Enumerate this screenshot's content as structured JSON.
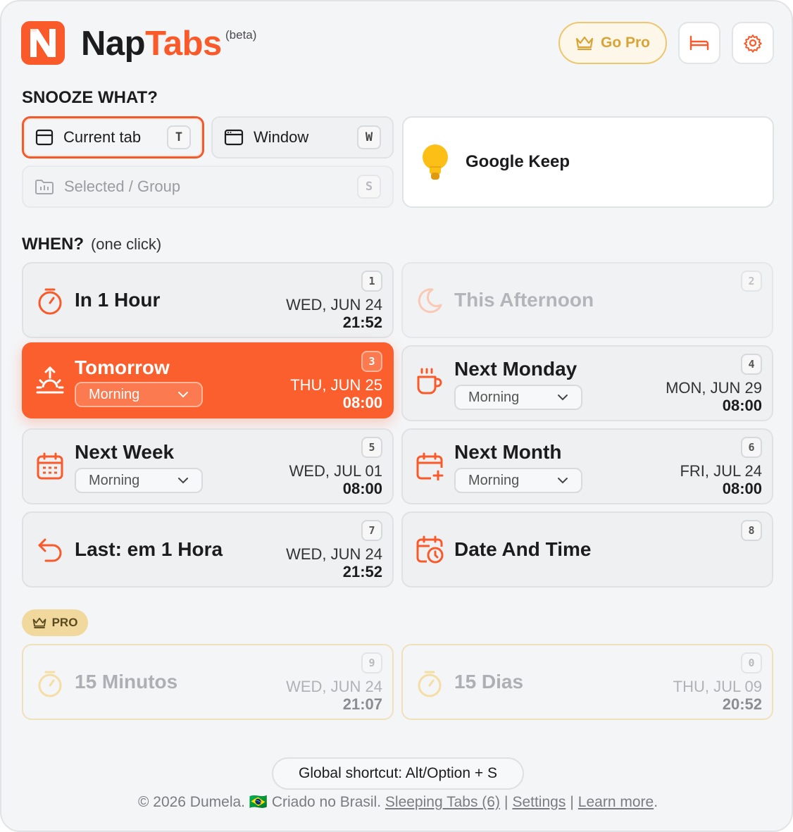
{
  "header": {
    "brand_first": "Nap",
    "brand_second": "Tabs",
    "beta": "(beta)",
    "go_pro": "Go Pro",
    "accent": "#fa5a2a",
    "pro_color": "#d9a437"
  },
  "snooze_what": {
    "title": "SNOOZE WHAT?",
    "options": [
      {
        "label": "Current tab",
        "key": "T",
        "icon": "tab-icon"
      },
      {
        "label": "Window",
        "key": "W",
        "icon": "window-icon"
      },
      {
        "label": "Selected / Group",
        "key": "S",
        "icon": "folder-group-icon"
      }
    ],
    "keep_label": "Google Keep"
  },
  "when": {
    "title": "WHEN?",
    "subtitle": "(one click)",
    "cards": [
      {
        "label": "In 1 Hour",
        "num": "1",
        "day": "WED, JUN 24",
        "time": "21:52",
        "icon": "stopwatch-icon"
      },
      {
        "label": "This Afternoon",
        "num": "2",
        "icon": "moon-icon"
      },
      {
        "label": "Tomorrow",
        "num": "3",
        "day": "THU, JUN 25",
        "time": "08:00",
        "select": "Morning",
        "icon": "sunrise-icon"
      },
      {
        "label": "Next Monday",
        "num": "4",
        "day": "MON, JUN 29",
        "time": "08:00",
        "select": "Morning",
        "icon": "coffee-icon"
      },
      {
        "label": "Next Week",
        "num": "5",
        "day": "WED, JUL 01",
        "time": "08:00",
        "select": "Morning",
        "icon": "calendar-icon"
      },
      {
        "label": "Next Month",
        "num": "6",
        "day": "FRI, JUL 24",
        "time": "08:00",
        "select": "Morning",
        "icon": "calendar-plus-icon"
      },
      {
        "label": "Last: em 1 Hora",
        "num": "7",
        "day": "WED, JUN 24",
        "time": "21:52",
        "icon": "undo-icon"
      },
      {
        "label": "Date And Time",
        "num": "8",
        "icon": "calendar-clock-icon"
      }
    ]
  },
  "pro": {
    "badge": "PRO",
    "cards": [
      {
        "label": "15 Minutos",
        "num": "9",
        "day": "WED, JUN 24",
        "time": "21:07"
      },
      {
        "label": "15 Dias",
        "num": "0",
        "day": "THU, JUL 09",
        "time": "20:52"
      }
    ]
  },
  "footer": {
    "shortcut": "Global shortcut: Alt/Option + S",
    "copyright": "© 2026 Dumela. 🇧🇷 Criado no Brasil.",
    "sleeping_tabs": "Sleeping Tabs (6)",
    "settings": "Settings",
    "learn_more": "Learn more",
    "period": "."
  }
}
